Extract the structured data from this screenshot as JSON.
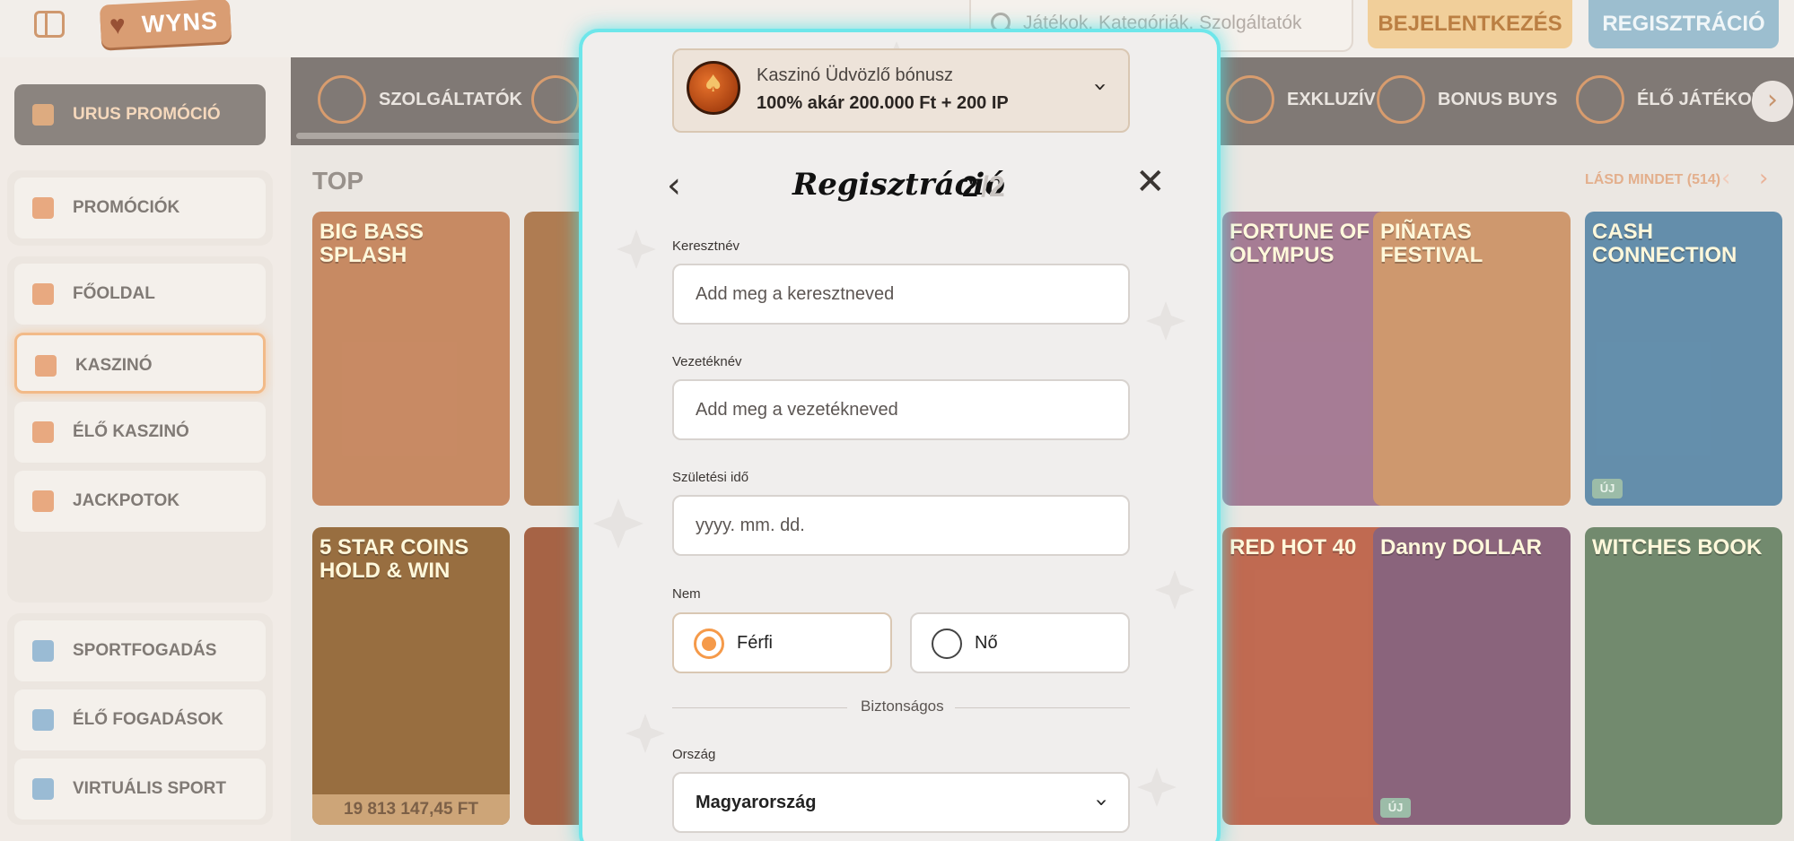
{
  "header": {
    "logo_text": "WYNS",
    "search_placeholder": "Játékok, Kategóriák, Szolgáltatók",
    "login_label": "BEJELENTKEZÉS",
    "register_label": "REGISZTRÁCIÓ"
  },
  "sidebar": {
    "promo_label": "URUS PROMÓCIÓ",
    "items": [
      {
        "label": "PROMÓCIÓK"
      },
      {
        "label": "FŐOLDAL"
      },
      {
        "label": "KASZINÓ"
      },
      {
        "label": "ÉLŐ KASZINÓ"
      },
      {
        "label": "JACKPOTOK"
      },
      {
        "label": "SPORTFOGADÁS"
      },
      {
        "label": "ÉLŐ FOGADÁSOK"
      },
      {
        "label": "VIRTUÁLIS SPORT"
      }
    ]
  },
  "categories": [
    {
      "label": "SZOLGÁLTATÓK"
    },
    {
      "label": "EXKLUZÍV"
    },
    {
      "label": "BONUS BUYS"
    },
    {
      "label": "ÉLŐ JÁTÉKOK"
    }
  ],
  "section": {
    "title": "TOP",
    "see_all": "LÁSD MINDET (514)"
  },
  "games": [
    {
      "title": "BIG BASS SPLASH",
      "color": "#c07a4e"
    },
    {
      "title": "",
      "color": "#a46a3b"
    },
    {
      "title": "FORTUNE OF OLYMPUS",
      "color": "#9a6a86"
    },
    {
      "title": "PIÑATAS FESTIVAL",
      "color": "#c88a5a"
    },
    {
      "title": "CASH CONNECTION",
      "color": "#4f7fa0",
      "badge": "ÚJ"
    },
    {
      "title": "5 STAR COINS HOLD & WIN",
      "color": "#8a5a26",
      "jackpot": "19 813 147,45 FT"
    },
    {
      "title": "",
      "color": "#9a4e2c"
    },
    {
      "title": "RED HOT 40",
      "color": "#b8563a"
    },
    {
      "title": "Danny DOLLAR",
      "color": "#7a4f6a",
      "badge": "ÚJ"
    },
    {
      "title": "WITCHES BOOK",
      "color": "#5f7a5a"
    }
  ],
  "modal": {
    "bonus_line1": "Kaszinó Üdvözlő bónusz",
    "bonus_line2": "100% akár 200.000 Ft + 200 IP",
    "title": "Regisztráció",
    "step": "2",
    "step_total": "/2",
    "first_name_label": "Keresztnév",
    "first_name_placeholder": "Add meg a keresztneved",
    "last_name_label": "Vezetéknév",
    "last_name_placeholder": "Add meg a vezetékneved",
    "birth_label": "Születési idő",
    "birth_placeholder": "yyyy. mm. dd.",
    "gender_label": "Nem",
    "gender_male": "Férfi",
    "gender_female": "Nő",
    "gender_selected": "Férfi",
    "separator_label": "Biztonságos",
    "country_label": "Ország",
    "country_value": "Magyarország"
  },
  "colors": {
    "accent_orange": "#f59a4a",
    "modal_glow": "#6ee6ea",
    "register_blue": "#8fb6c9",
    "login_orange": "#f0c98d"
  }
}
